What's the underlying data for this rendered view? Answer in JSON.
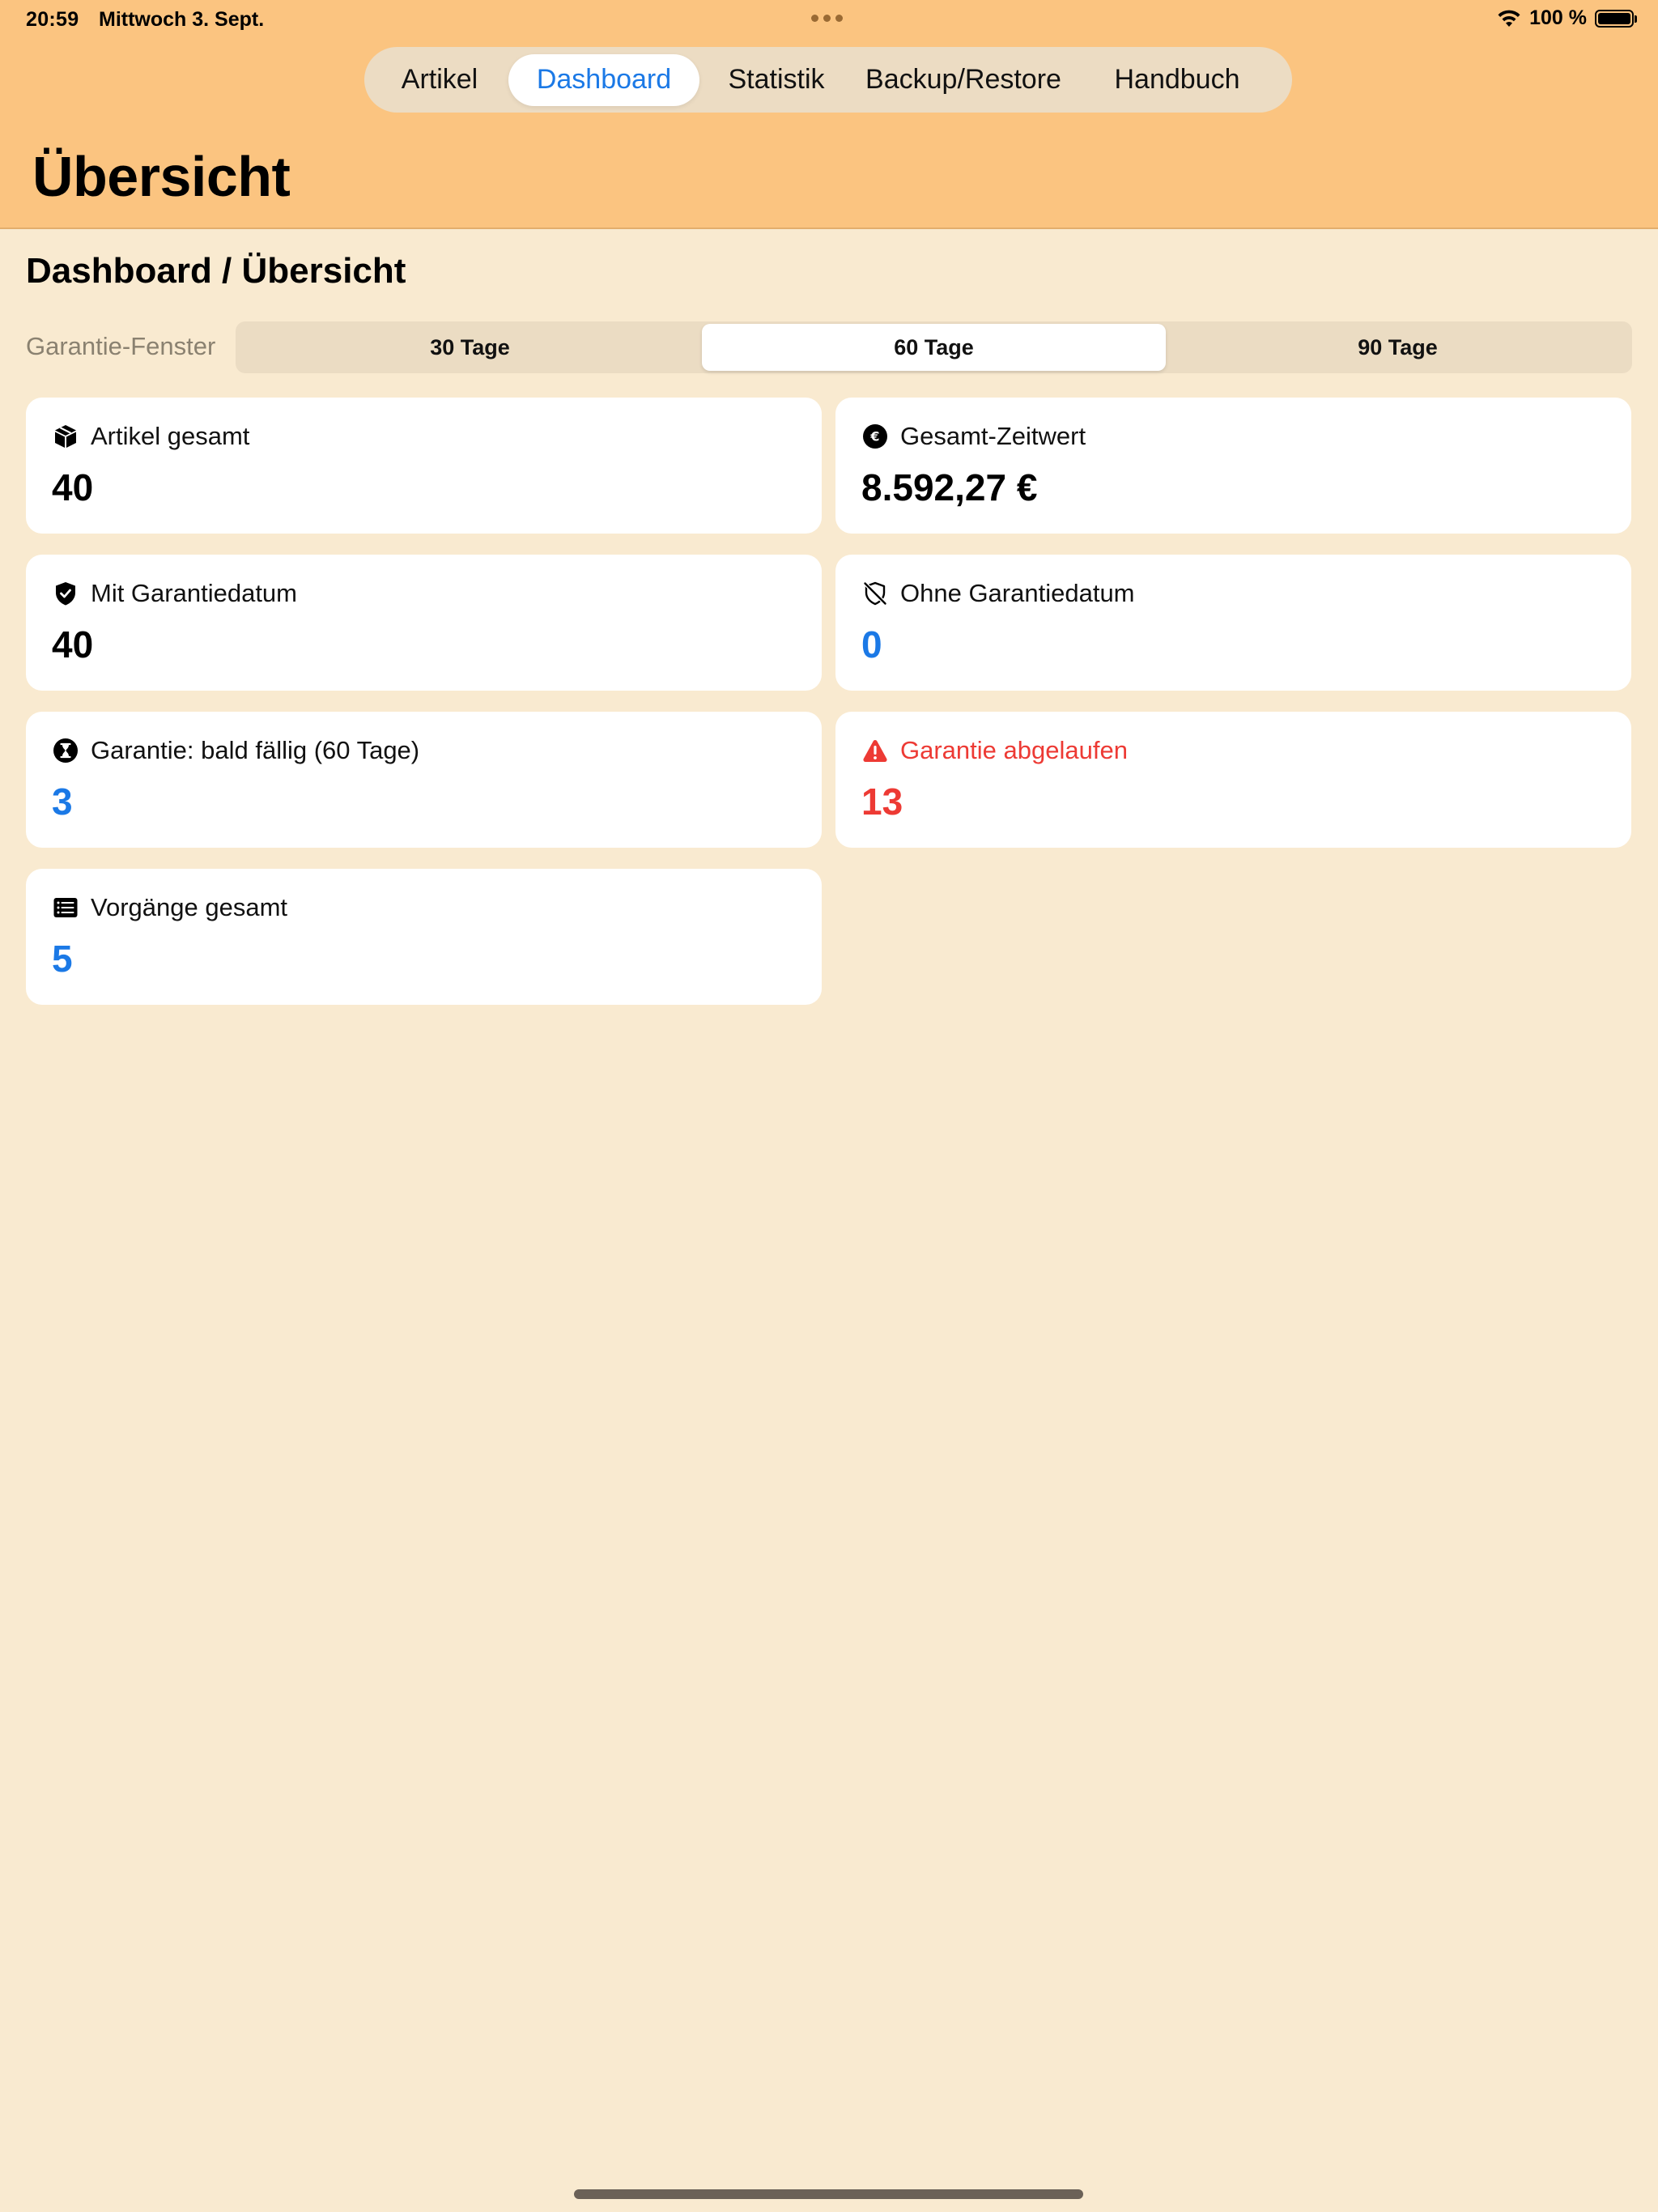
{
  "status_bar": {
    "time": "20:59",
    "date": "Mittwoch 3. Sept.",
    "battery_text": "100 %"
  },
  "tabs": [
    {
      "label": "Artikel",
      "active": false
    },
    {
      "label": "Dashboard",
      "active": true
    },
    {
      "label": "Statistik",
      "active": false
    },
    {
      "label": "Backup/Restore",
      "active": false
    },
    {
      "label": "Handbuch",
      "active": false
    }
  ],
  "large_title": "Übersicht",
  "section_title": "Dashboard / Übersicht",
  "warranty_window": {
    "label": "Garantie-Fenster",
    "options": [
      "30 Tage",
      "60 Tage",
      "90 Tage"
    ],
    "selected": "60 Tage"
  },
  "cards": [
    {
      "icon": "package-icon",
      "label": "Artikel gesamt",
      "value": "40",
      "value_color": "#000000"
    },
    {
      "icon": "euro-circle-icon",
      "label": "Gesamt-Zeitwert",
      "value": "8.592,27 €",
      "value_color": "#000000"
    },
    {
      "icon": "shield-check-icon",
      "label": "Mit Garantiedatum",
      "value": "40",
      "value_color": "#000000"
    },
    {
      "icon": "shield-slash-icon",
      "label": "Ohne Garantiedatum",
      "value": "0",
      "value_color": "#1b79e6"
    },
    {
      "icon": "hourglass-circle-icon",
      "label": "Garantie: bald fällig (60 Tage)",
      "value": "3",
      "value_color": "#1b79e6"
    },
    {
      "icon": "warning-triangle-icon",
      "label": "Garantie abgelaufen",
      "value": "13",
      "value_color": "#ed3a34"
    },
    {
      "icon": "list-icon",
      "label": "Vorgänge gesamt",
      "value": "5",
      "value_color": "#1b79e6"
    }
  ],
  "colors": {
    "header_bg": "#fbc480",
    "page_bg": "#f9ead0",
    "accent_blue": "#1b79e6",
    "alert_red": "#ed3a34"
  }
}
